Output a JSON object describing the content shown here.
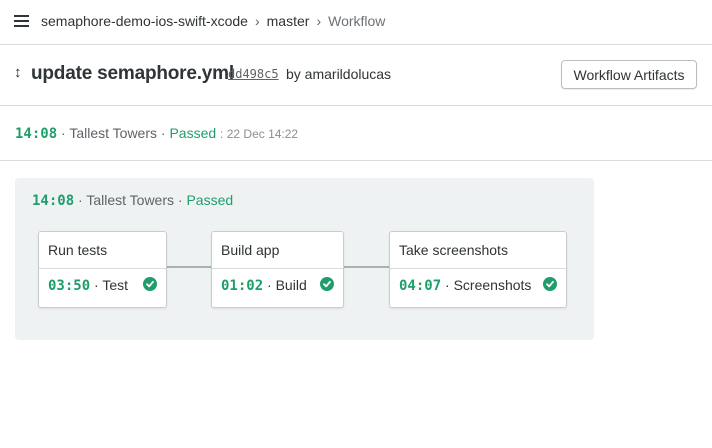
{
  "breadcrumb": {
    "project": "semaphore-demo-ios-swift-xcode",
    "branch": "master",
    "current": "Workflow",
    "separator": "›"
  },
  "commit": {
    "icon": "commit-arrow-icon",
    "icon_glyph": "↕",
    "title": "update semaphore.yml",
    "sha": "dd498c5",
    "by_text": "by amarildolucas"
  },
  "artifacts_button": {
    "label": "Workflow Artifacts"
  },
  "summary": {
    "duration": "14:08",
    "pipeline": "· Tallest Towers ·",
    "status": "Passed",
    "date": ": 22 Dec 14:22"
  },
  "pipeline": {
    "duration": "14:08",
    "name": "· Tallest Towers ·",
    "status": "Passed",
    "blocks": [
      {
        "name": "Run tests",
        "job_time": "03:50",
        "job_name": "· Test",
        "status_icon": "check-circle-icon"
      },
      {
        "name": "Build app",
        "job_time": "01:02",
        "job_name": "· Build",
        "status_icon": "check-circle-icon"
      },
      {
        "name": "Take screenshots",
        "job_time": "04:07",
        "job_name": "· Screenshots",
        "status_icon": "check-circle-icon"
      }
    ]
  },
  "colors": {
    "accent_green": "#1f9e6b",
    "panel_bg": "#eff2f3",
    "connector": "#a7b2ae",
    "border": "#d9dcdf"
  }
}
